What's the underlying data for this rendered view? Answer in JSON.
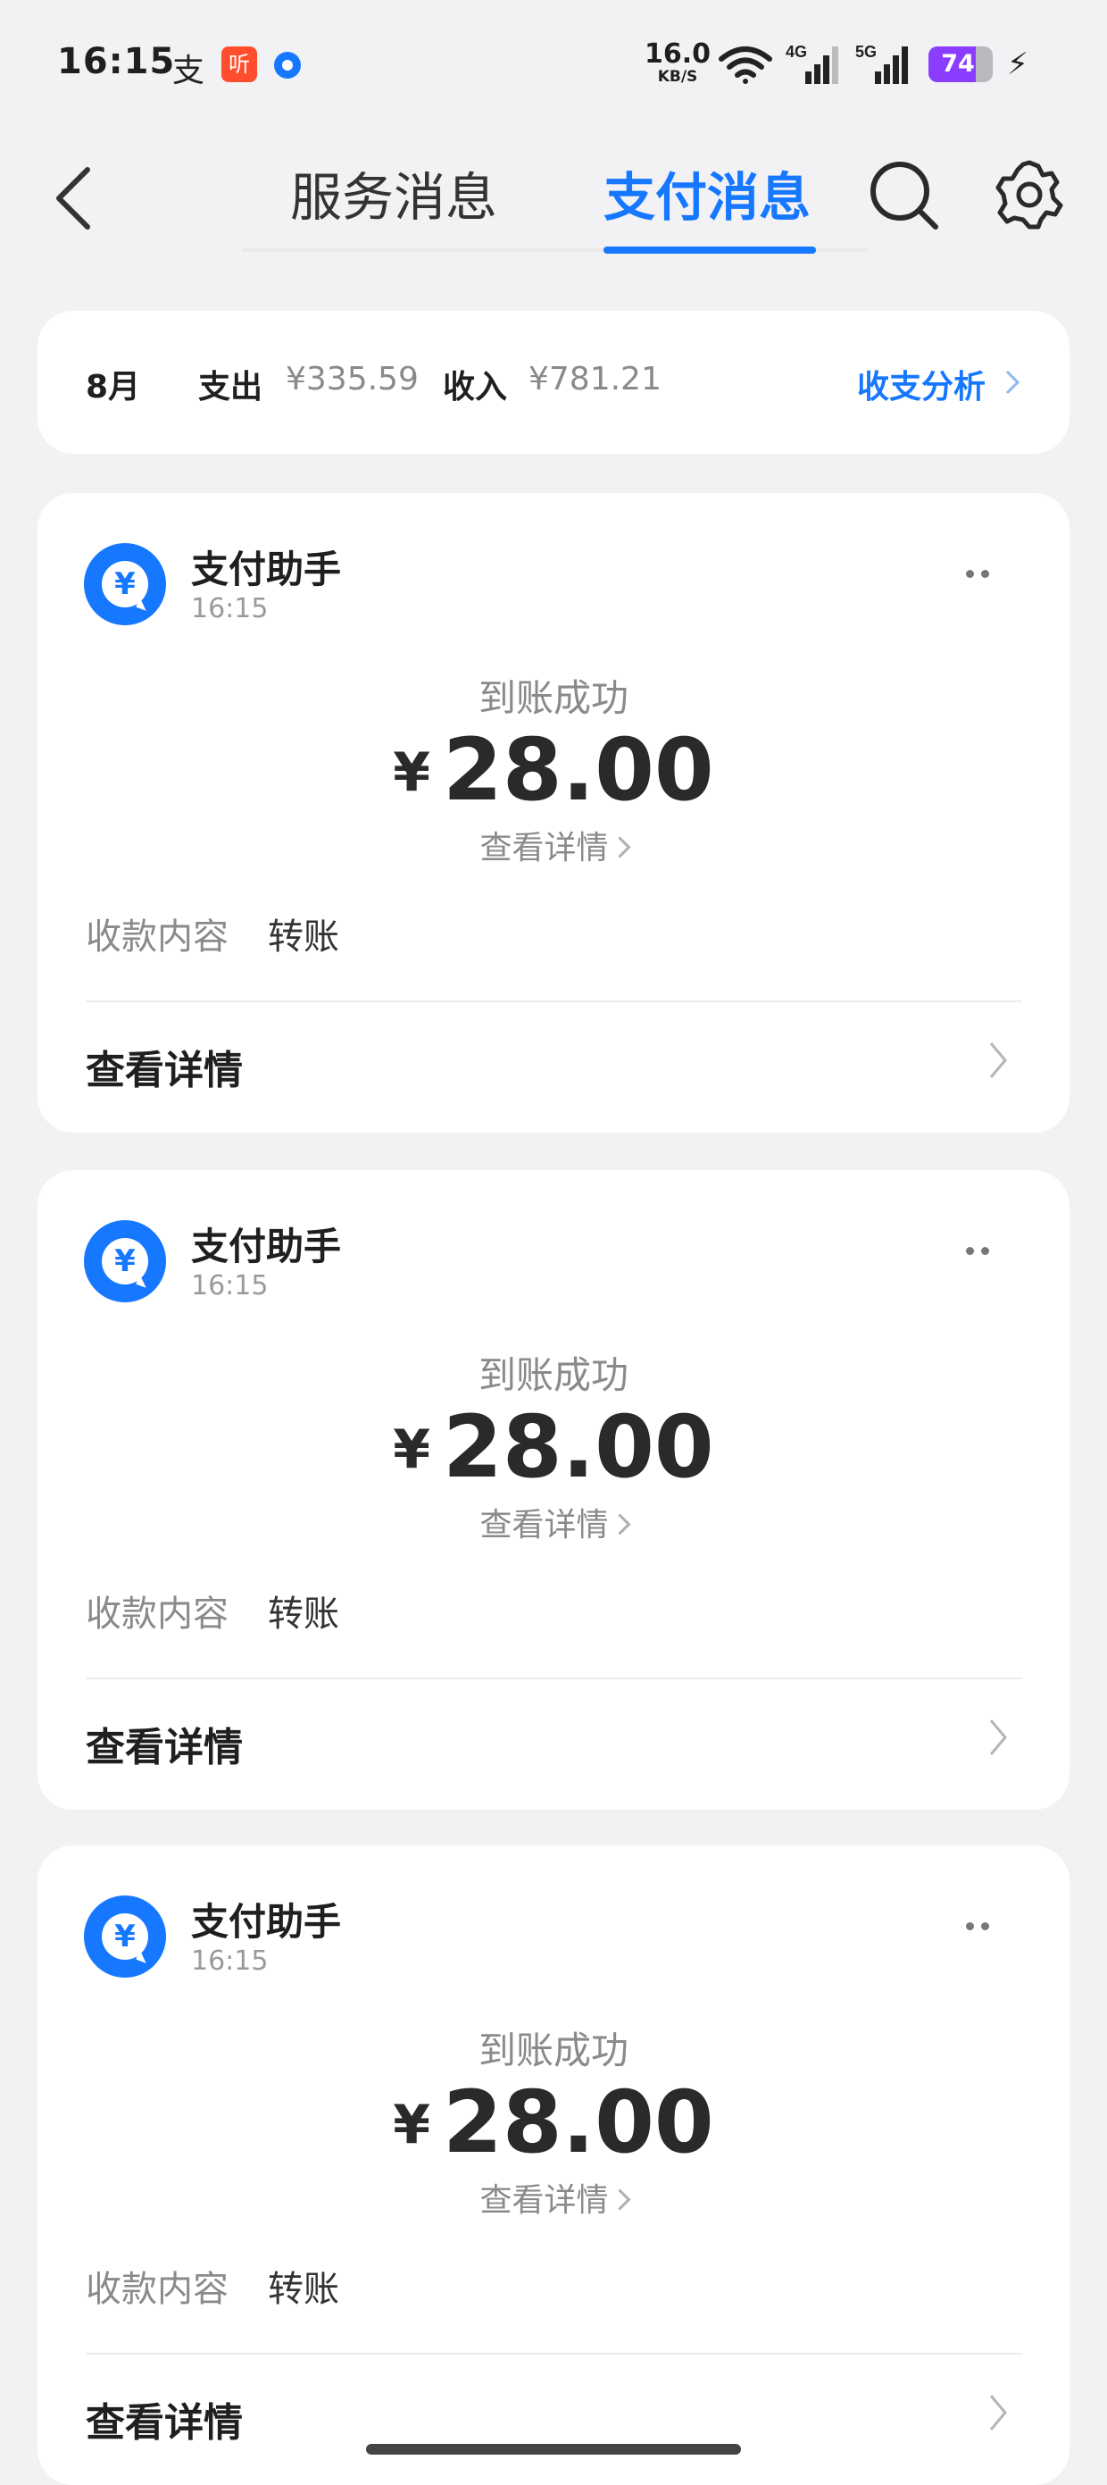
{
  "status_bar": {
    "time": "16:15",
    "app1": "支",
    "app2": "听",
    "speed_value": "16.0",
    "speed_unit": "KB/S",
    "net1": "4G",
    "net2": "5G",
    "battery_percent": "74",
    "battery_level": 0.74
  },
  "nav": {
    "tab_service": "服务消息",
    "tab_payment": "支付消息"
  },
  "summary": {
    "month": "8月",
    "expense_label": "支出",
    "expense_value": "¥335.59",
    "income_label": "收入",
    "income_value": "¥781.21",
    "analysis_link": "收支分析"
  },
  "cards": [
    {
      "sender": "支付助手",
      "time": "16:15",
      "status": "到账成功",
      "currency": "¥",
      "amount": "28.00",
      "detail_small": "查看详情",
      "field_label": "收款内容",
      "field_value": "转账",
      "detail_link": "查看详情"
    },
    {
      "sender": "支付助手",
      "time": "16:15",
      "status": "到账成功",
      "currency": "¥",
      "amount": "28.00",
      "detail_small": "查看详情",
      "field_label": "收款内容",
      "field_value": "转账",
      "detail_link": "查看详情"
    },
    {
      "sender": "支付助手",
      "time": "16:15",
      "status": "到账成功",
      "currency": "¥",
      "amount": "28.00",
      "detail_small": "查看详情",
      "field_label": "收款内容",
      "field_value": "转账",
      "detail_link": "查看详情"
    }
  ],
  "avatar_symbol": "¥",
  "colors": {
    "accent": "#1677ff",
    "background": "#f2f2f4",
    "battery": "#8b3dff"
  }
}
